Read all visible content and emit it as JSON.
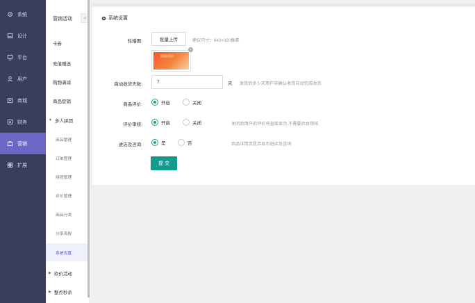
{
  "nav1": [
    {
      "label": "系统",
      "icon": "gear-icon"
    },
    {
      "label": "设计",
      "icon": "design-icon"
    },
    {
      "label": "平台",
      "icon": "monitor-icon"
    },
    {
      "label": "用户",
      "icon": "user-icon"
    },
    {
      "label": "商城",
      "icon": "shop-icon"
    },
    {
      "label": "财务",
      "icon": "finance-icon"
    },
    {
      "label": "营销",
      "icon": "marketing-icon"
    },
    {
      "label": "扩展",
      "icon": "grid-icon"
    }
  ],
  "nav2": {
    "title": "营销活动",
    "collapse": "«",
    "items": [
      "卡券",
      "充值赠送",
      "购物满减",
      "商品促销"
    ],
    "group_open": "多人拼团",
    "sub_items": [
      "商品管理",
      "订单管理",
      "拼团管理",
      "评价管理",
      "商品分类",
      "分享海报",
      "系统设置"
    ],
    "group_collapsed": [
      "砍价活动",
      "整点秒杀"
    ]
  },
  "main": {
    "title": "系统设置",
    "carousel_label": "轮播图:",
    "upload_button": "批量上传",
    "size_hint": "建议尺寸：640×320像素",
    "thumb_tag": "超值拼团价",
    "thumb_remove": "×",
    "auto_days_label": "自动收货天数:",
    "auto_days_value": "7",
    "auto_days_unit": "天",
    "auto_days_hint": "发货后多少天用户未确认收货自动完成收货",
    "review_label": "商品评价:",
    "review_on": "开启",
    "review_off": "关闭",
    "audit_label": "评价审核:",
    "audit_on": "开启",
    "audit_off": "关闭",
    "audit_hint": "关闭后用户的评价将直接显示,不需要后台审核",
    "consult_label": "进店及咨询:",
    "consult_yes": "是",
    "consult_no": "否",
    "consult_hint": "商品详情页是否显示进店及咨询",
    "submit": "提 交"
  },
  "colors": {
    "sidebar": "#393d5e",
    "active": "#6a67c7",
    "accent": "#169a8c"
  }
}
